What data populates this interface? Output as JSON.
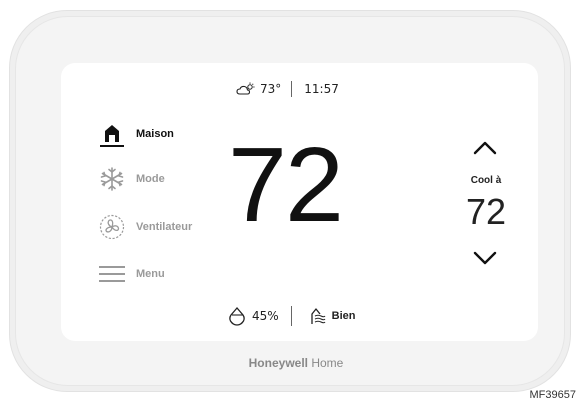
{
  "status": {
    "outdoor_temp": "73°",
    "time": "11:57"
  },
  "nav": {
    "items": [
      {
        "label": "Maison"
      },
      {
        "label": "Mode"
      },
      {
        "label": "Ventilateur"
      },
      {
        "label": "Menu"
      }
    ]
  },
  "indoor_temp": "72",
  "setpoint": {
    "mode_label": "Cool à",
    "value": "72"
  },
  "bottom": {
    "humidity": "45%",
    "air_quality": "Bien"
  },
  "brand": {
    "name_bold": "Honeywell",
    "name_light": "Home"
  },
  "figure_code": "MF39657",
  "colors": {
    "active": "#111111",
    "muted": "#9a9a9a",
    "device": "#efefef"
  }
}
